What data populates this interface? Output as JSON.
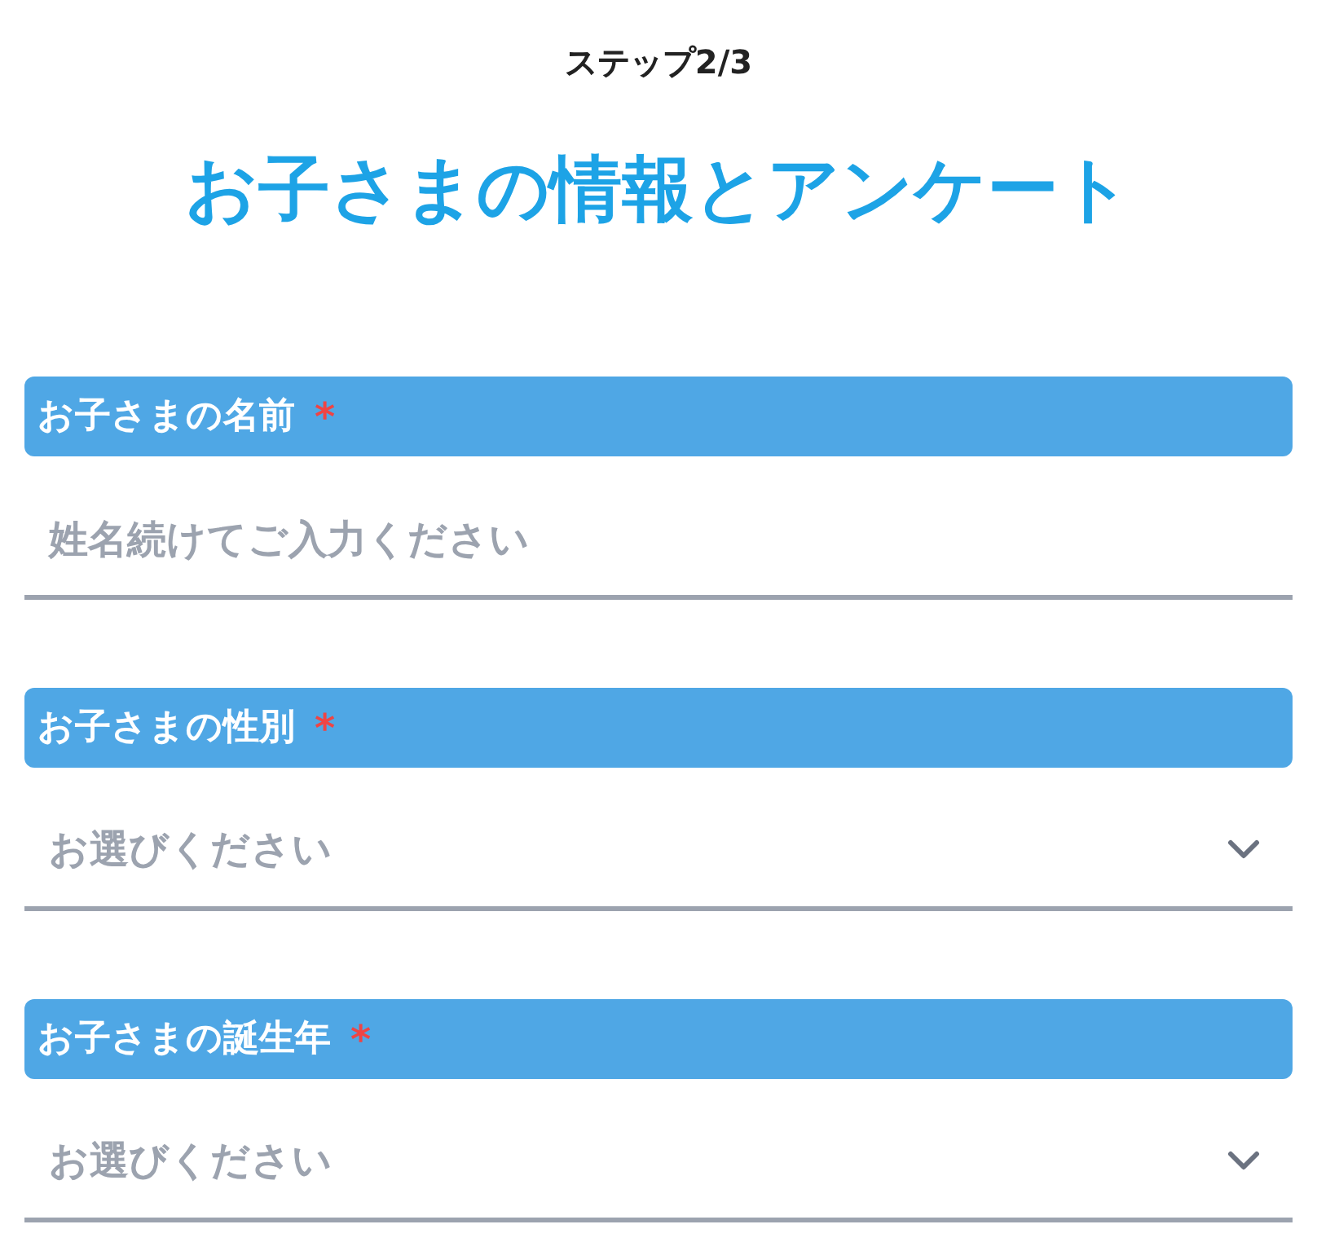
{
  "step": "ステップ2/3",
  "title": "お子さまの情報とアンケート",
  "fields": [
    {
      "kind": "text",
      "label": "お子さまの名前",
      "required": true,
      "required_mark": "*",
      "placeholder": "姓名続けてご入力ください"
    },
    {
      "kind": "select",
      "label": "お子さまの性別",
      "required": true,
      "required_mark": "*",
      "placeholder": "お選びください"
    },
    {
      "kind": "select",
      "label": "お子さまの誕生年",
      "required": true,
      "required_mark": "*",
      "placeholder": "お選びください"
    }
  ]
}
